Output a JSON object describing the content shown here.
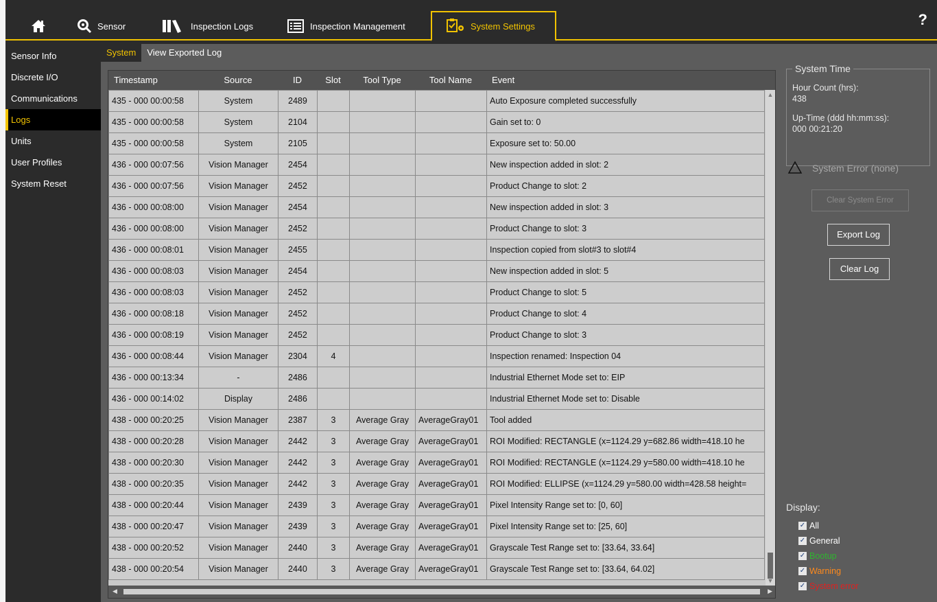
{
  "nav": {
    "tabs": [
      {
        "label": ""
      },
      {
        "label": "Sensor"
      },
      {
        "label": "Inspection Logs"
      },
      {
        "label": "Inspection Management"
      },
      {
        "label": "System Settings"
      }
    ],
    "help": "?"
  },
  "sidebar": {
    "items": [
      {
        "label": "Sensor Info"
      },
      {
        "label": "Discrete I/O"
      },
      {
        "label": "Communications"
      },
      {
        "label": "Logs"
      },
      {
        "label": "Units"
      },
      {
        "label": "User Profiles"
      },
      {
        "label": "System Reset"
      }
    ]
  },
  "subtabs": [
    {
      "label": "System"
    },
    {
      "label": "View Exported Log"
    }
  ],
  "grid": {
    "columns": [
      "Timestamp",
      "Source",
      "ID",
      "Slot",
      "Tool Type",
      "Tool Name",
      "Event"
    ],
    "rows": [
      [
        "435 - 000 00:00:58",
        "System",
        "2489",
        "",
        "",
        "",
        "Auto Exposure completed successfully"
      ],
      [
        "435 - 000 00:00:58",
        "System",
        "2104",
        "",
        "",
        "",
        "Gain set to:  0"
      ],
      [
        "435 - 000 00:00:58",
        "System",
        "2105",
        "",
        "",
        "",
        "Exposure set to:  50.00"
      ],
      [
        "436 - 000 00:07:56",
        "Vision Manager",
        "2454",
        "",
        "",
        "",
        "New inspection added in slot: 2"
      ],
      [
        "436 - 000 00:07:56",
        "Vision Manager",
        "2452",
        "",
        "",
        "",
        "Product Change to slot: 2"
      ],
      [
        "436 - 000 00:08:00",
        "Vision Manager",
        "2454",
        "",
        "",
        "",
        "New inspection added in slot: 3"
      ],
      [
        "436 - 000 00:08:00",
        "Vision Manager",
        "2452",
        "",
        "",
        "",
        "Product Change to slot: 3"
      ],
      [
        "436 - 000 00:08:01",
        "Vision Manager",
        "2455",
        "",
        "",
        "",
        "Inspection copied  from slot#3 to slot#4"
      ],
      [
        "436 - 000 00:08:03",
        "Vision Manager",
        "2454",
        "",
        "",
        "",
        "New inspection added in slot: 5"
      ],
      [
        "436 - 000 00:08:03",
        "Vision Manager",
        "2452",
        "",
        "",
        "",
        "Product Change to slot: 5"
      ],
      [
        "436 - 000 00:08:18",
        "Vision Manager",
        "2452",
        "",
        "",
        "",
        "Product Change to slot: 4"
      ],
      [
        "436 - 000 00:08:19",
        "Vision Manager",
        "2452",
        "",
        "",
        "",
        "Product Change to slot: 3"
      ],
      [
        "436 - 000 00:08:44",
        "Vision Manager",
        "2304",
        "4",
        "",
        "",
        "Inspection renamed:  Inspection 04"
      ],
      [
        "436 - 000 00:13:34",
        "-",
        "2486",
        "",
        "",
        "",
        "Industrial Ethernet Mode set to: EIP"
      ],
      [
        "436 - 000 00:14:02",
        "Display",
        "2486",
        "",
        "",
        "",
        "Industrial Ethernet Mode set to: Disable"
      ],
      [
        "438 - 000 00:20:25",
        "Vision Manager",
        "2387",
        "3",
        "Average Gray",
        "AverageGray01",
        "Tool added"
      ],
      [
        "438 - 000 00:20:28",
        "Vision Manager",
        "2442",
        "3",
        "Average Gray",
        "AverageGray01",
        "ROI Modified: RECTANGLE (x=1124.29 y=682.86 width=418.10 he"
      ],
      [
        "438 - 000 00:20:30",
        "Vision Manager",
        "2442",
        "3",
        "Average Gray",
        "AverageGray01",
        "ROI Modified: RECTANGLE (x=1124.29 y=580.00 width=418.10 he"
      ],
      [
        "438 - 000 00:20:35",
        "Vision Manager",
        "2442",
        "3",
        "Average Gray",
        "AverageGray01",
        "ROI Modified: ELLIPSE (x=1124.29 y=580.00 width=428.58 height="
      ],
      [
        "438 - 000 00:20:44",
        "Vision Manager",
        "2439",
        "3",
        "Average Gray",
        "AverageGray01",
        "Pixel Intensity Range set to:  [0, 60]"
      ],
      [
        "438 - 000 00:20:47",
        "Vision Manager",
        "2439",
        "3",
        "Average Gray",
        "AverageGray01",
        "Pixel Intensity Range set to:  [25, 60]"
      ],
      [
        "438 - 000 00:20:52",
        "Vision Manager",
        "2440",
        "3",
        "Average Gray",
        "AverageGray01",
        "Grayscale Test Range set to:  [33.64, 33.64]"
      ],
      [
        "438 - 000 00:20:54",
        "Vision Manager",
        "2440",
        "3",
        "Average Gray",
        "AverageGray01",
        "Grayscale Test Range set to:  [33.64, 64.02]"
      ]
    ]
  },
  "system_time": {
    "legend": "System Time",
    "hour_count_label": "Hour Count (hrs):",
    "hour_count_value": "438",
    "uptime_label": "Up-Time (ddd hh:mm:ss):",
    "uptime_value": "000 00:21:20"
  },
  "system_error": {
    "label": "System Error (none)"
  },
  "buttons": {
    "clear_system_error": "Clear System Error",
    "export_log": "Export Log",
    "clear_log": "Clear Log"
  },
  "display": {
    "title": "Display:",
    "options": [
      {
        "label": "All",
        "checked": true,
        "color": "#ffffff"
      },
      {
        "label": "General",
        "checked": true,
        "color": "#ffffff"
      },
      {
        "label": "Bootup",
        "checked": true,
        "color": "#2fb52f"
      },
      {
        "label": "Warning",
        "checked": true,
        "color": "#ff8a1c"
      },
      {
        "label": "System error",
        "checked": true,
        "color": "#e02020"
      }
    ]
  },
  "colors": {
    "accent": "#f2c300"
  }
}
